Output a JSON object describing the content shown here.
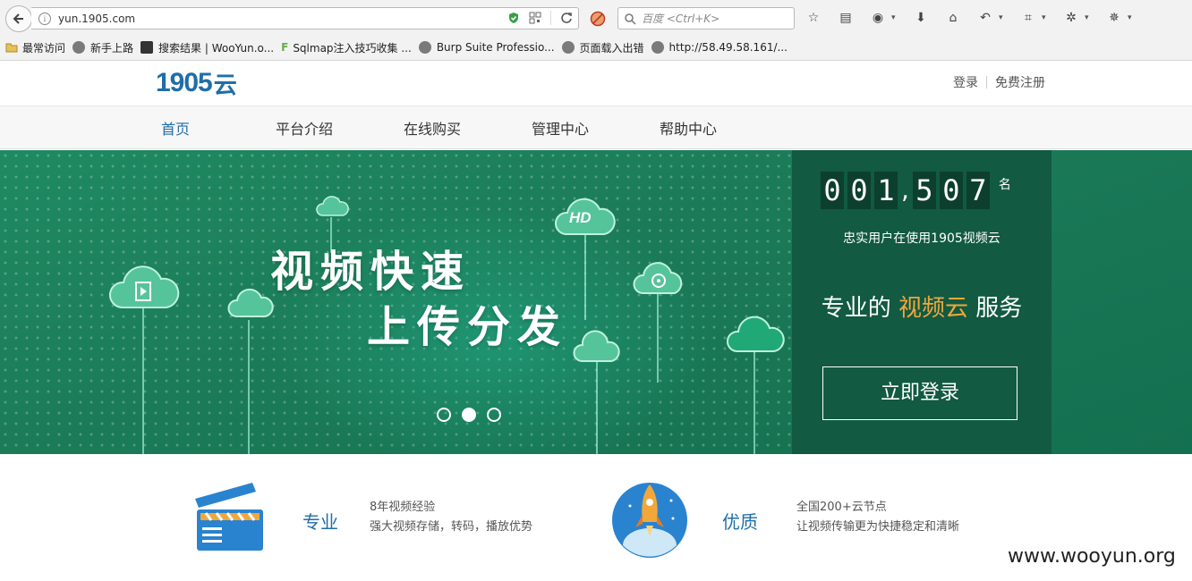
{
  "browser": {
    "url": "yun.1905.com",
    "search_placeholder": "百度 <Ctrl+K>",
    "bookmarks": [
      "最常访问",
      "新手上路",
      "搜索结果 | WooYun.o...",
      "Sqlmap注入技巧收集 ...",
      "Burp Suite Professio...",
      "页面载入出错",
      "http://58.49.58.161/..."
    ]
  },
  "header": {
    "logo_text": "1905",
    "logo_suffix": "云",
    "login": "登录",
    "register": "免费注册"
  },
  "nav": {
    "items": [
      "首页",
      "平台介绍",
      "在线购买",
      "管理中心",
      "帮助中心"
    ],
    "active": "首页"
  },
  "hero": {
    "slogan_line1": "视频快速",
    "slogan_line2": "上传分发",
    "hd_label": "HD",
    "carousel": {
      "count": 3,
      "active_index": 1
    }
  },
  "panel": {
    "digits": [
      "0",
      "0",
      "1",
      "5",
      "0",
      "7"
    ],
    "count_unit": "名",
    "users_text": "忠实用户在使用1905视频云",
    "pro_prefix": "专业的",
    "pro_highlight": "视频云",
    "pro_suffix": "服务",
    "login_button": "立即登录"
  },
  "features": [
    {
      "title": "专业",
      "line1": "8年视频经验",
      "line2": "强大视频存储，转码，播放优势"
    },
    {
      "title": "优质",
      "line1": "全国200+云节点",
      "line2": "让视频传输更为快捷稳定和清晰"
    }
  ],
  "watermark": "www.wooyun.org",
  "colors": {
    "brand_blue": "#1f6ea8",
    "hero_green": "#1b7a58",
    "panel_green": "#125a42",
    "accent_orange": "#f2a73b"
  }
}
